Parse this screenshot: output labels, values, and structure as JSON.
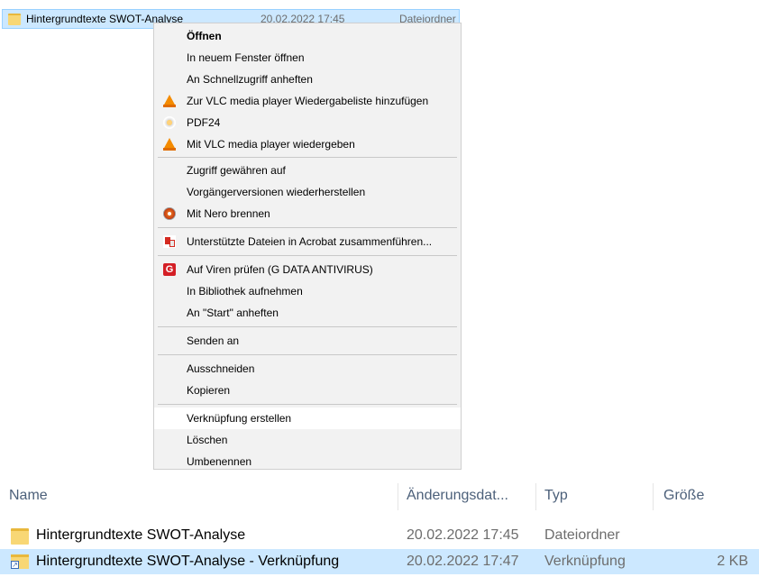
{
  "top_row": {
    "name": "Hintergrundtexte SWOT-Analyse",
    "date": "20.02.2022 17:45",
    "type": "Dateiordner"
  },
  "context_menu": {
    "items": [
      {
        "label": "Öffnen",
        "icon": ""
      },
      {
        "label": "In neuem Fenster öffnen",
        "icon": ""
      },
      {
        "label": "An Schnellzugriff anheften",
        "icon": ""
      },
      {
        "label": "Zur VLC media player Wiedergabeliste hinzufügen",
        "icon": "vlc-icon"
      },
      {
        "label": "PDF24",
        "icon": "pdf24-icon"
      },
      {
        "label": "Mit VLC media player wiedergeben",
        "icon": "vlc-icon"
      },
      {
        "label": "Zugriff gewähren auf",
        "icon": ""
      },
      {
        "label": "Vorgängerversionen wiederherstellen",
        "icon": ""
      },
      {
        "label": "Mit Nero brennen",
        "icon": "nero-icon"
      },
      {
        "label": "Unterstützte Dateien in Acrobat zusammenführen...",
        "icon": "acrobat-icon"
      },
      {
        "label": "Auf Viren prüfen (G DATA ANTIVIRUS)",
        "icon": "gdata-icon"
      },
      {
        "label": "In Bibliothek aufnehmen",
        "icon": ""
      },
      {
        "label": "An \"Start\" anheften",
        "icon": ""
      },
      {
        "label": "Senden an",
        "icon": ""
      },
      {
        "label": "Ausschneiden",
        "icon": ""
      },
      {
        "label": "Kopieren",
        "icon": ""
      },
      {
        "label": "Verknüpfung erstellen",
        "icon": ""
      },
      {
        "label": "Löschen",
        "icon": ""
      },
      {
        "label": "Umbenennen",
        "icon": ""
      }
    ],
    "gdata_glyph": "G"
  },
  "columns": {
    "name": "Name",
    "date": "Änderungsdat...",
    "type": "Typ",
    "size": "Größe"
  },
  "files": [
    {
      "name": "Hintergrundtexte SWOT-Analyse",
      "date": "20.02.2022 17:45",
      "type": "Dateiordner",
      "size": ""
    },
    {
      "name": "Hintergrundtexte SWOT-Analyse - Verknüpfung",
      "date": "20.02.2022 17:47",
      "type": "Verknüpfung",
      "size": "2 KB"
    }
  ],
  "colors": {
    "selection": "#cce8ff",
    "menu_bg": "#f2f2f2",
    "header_text": "#4c607a"
  }
}
